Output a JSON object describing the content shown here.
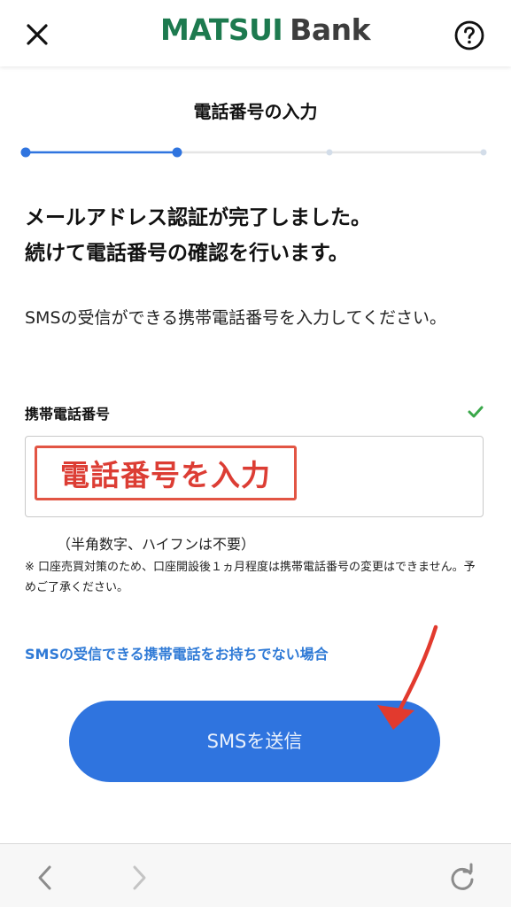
{
  "header": {
    "logo_text_1": "MATSUI",
    "logo_text_2": "Bank",
    "close_icon": "close-icon",
    "help_icon": "question-circle-icon"
  },
  "step": {
    "title": "電話番号の入力",
    "current": 2,
    "total": 4
  },
  "content": {
    "heading_line1": "メールアドレス認証が完了しました。",
    "heading_line2": "続けて電話番号の確認を行います。",
    "description": "SMSの受信ができる携帯電話番号を入力してください。"
  },
  "form": {
    "field_label": "携帯電話番号",
    "input_placeholder": "電話番号を入力",
    "hint": "（半角数字、ハイフンは不要）",
    "note": "※ 口座売買対策のため、口座開設後１ヵ月程度は携帯電話番号の変更はできません。予めご了承ください。"
  },
  "link": {
    "no_sms_phone": "SMSの受信できる携帯電話をお持ちでない場合"
  },
  "button": {
    "send_sms": "SMSを送信"
  },
  "browser_bar": {
    "back_icon": "chevron-left-icon",
    "forward_icon": "chevron-right-icon",
    "reload_icon": "reload-icon"
  },
  "colors": {
    "brand_green": "#1d7a4f",
    "accent_blue": "#2f74df",
    "link_blue": "#2f7ad6",
    "check_green": "#3aa84a",
    "annotation_red": "#dc3d34"
  }
}
